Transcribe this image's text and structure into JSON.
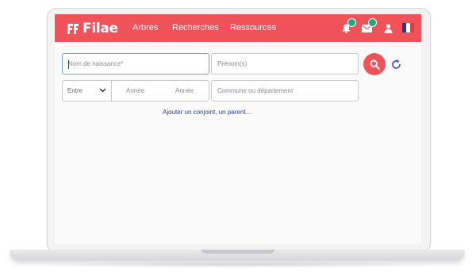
{
  "colors": {
    "brand": "#f0525a",
    "badge": "#21a77e",
    "link": "#2b3fa1",
    "reset_icon": "#4a4fd1"
  },
  "header": {
    "logo_text": "Filae",
    "nav": [
      {
        "label": "Arbres"
      },
      {
        "label": "Recherches"
      },
      {
        "label": "Ressources"
      }
    ],
    "icons": [
      "bell-icon",
      "mail-icon",
      "user-icon",
      "flag-fr-icon"
    ]
  },
  "search": {
    "lastname": {
      "value": "",
      "placeholder": "Nom de naissance*"
    },
    "firstname": {
      "value": "",
      "placeholder": "Prénom(s)"
    },
    "date_mode": {
      "selected": "Entre"
    },
    "year_from": {
      "placeholder": "Année"
    },
    "year_to": {
      "placeholder": "Année"
    },
    "place": {
      "value": "",
      "placeholder": "Commune ou département"
    },
    "add_relative_label": "Ajouter un conjoint, un parent..."
  }
}
